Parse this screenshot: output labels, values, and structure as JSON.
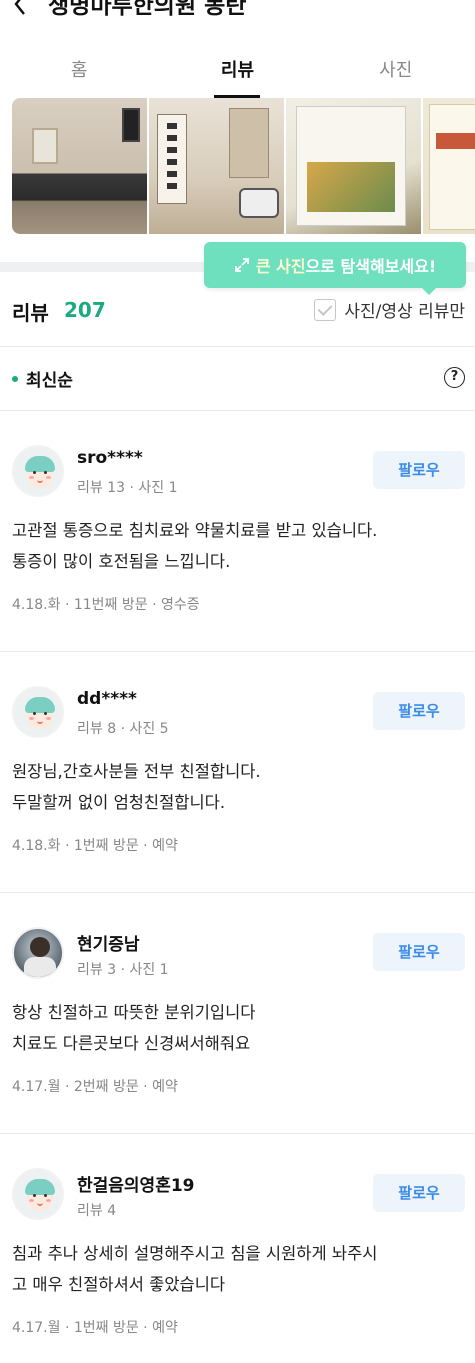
{
  "header": {
    "title": "생명마루한의원 동탄"
  },
  "tabs": [
    {
      "label": "홈"
    },
    {
      "label": "리뷰"
    },
    {
      "label": "사진"
    }
  ],
  "tooltip": {
    "highlight": "큰 사진",
    "rest": "으로 탐색해보세요!"
  },
  "review_header": {
    "title": "리뷰",
    "count": "207",
    "photo_filter_label": "사진/영상 리뷰만"
  },
  "sort": {
    "label": "최신순",
    "help": "?"
  },
  "reviews": [
    {
      "name": "sro****",
      "meta": "리뷰 13 · 사진 1",
      "follow": "팔로우",
      "line1": "고관절 통증으로 침치료와 약물치료를 받고 있습니다.",
      "line2": "통증이 많이 호전됨을 느낍니다.",
      "info": "4.18.화 · 11번째 방문 · 영수증"
    },
    {
      "name": "dd****",
      "meta": "리뷰 8 · 사진 5",
      "follow": "팔로우",
      "line1": "원장님,간호사분들 전부 친절합니다.",
      "line2": "두말할꺼 없이 엄청친절합니다.",
      "info": "4.18.화 · 1번째 방문 · 예약"
    },
    {
      "name": "현기증남",
      "meta": "리뷰 3 · 사진 1",
      "follow": "팔로우",
      "line1": "항상 친절하고 따뜻한 분위기입니다",
      "line2": "치료도 다른곳보다 신경써서해줘요",
      "info": "4.17.월 · 2번째 방문 · 예약"
    },
    {
      "name": "한걸음의영혼19",
      "meta": "리뷰 4",
      "follow": "팔로우",
      "line1": "침과 추나 상세히 설명해주시고 침을 시원하게 놔주시",
      "line2": "고 매우 친절하셔서 좋았습니다",
      "info": "4.17.월 · 1번째 방문 · 예약"
    }
  ],
  "colors": {
    "accent_green": "#1bab7f",
    "follow_blue": "#3a8ce8",
    "tooltip_bg": "#6fe0be"
  }
}
